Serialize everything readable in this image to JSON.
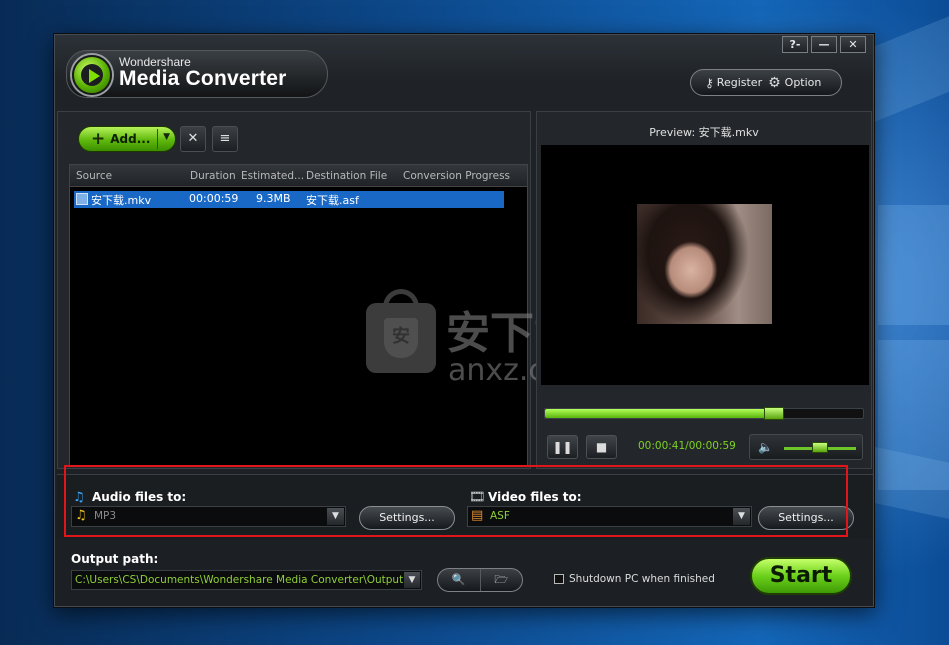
{
  "app": {
    "brand": "Wondershare",
    "product": "Media Converter"
  },
  "window_controls": {
    "help": "?-",
    "minimize": "—",
    "close": "✕"
  },
  "header": {
    "register_label": "Register",
    "option_label": "Option"
  },
  "toolbar": {
    "add_label": "Add..."
  },
  "file_list": {
    "columns": [
      "Source",
      "Duration",
      "Estimated...",
      "Destination File",
      "Conversion Progress"
    ],
    "rows": [
      {
        "source": "安下载.mkv",
        "duration": "00:00:59",
        "estimated": "9.3MB",
        "destination": "安下载.asf",
        "progress": ""
      }
    ]
  },
  "watermark": {
    "cn": "安下载",
    "en": "anxz.com",
    "mark": "安"
  },
  "preview": {
    "title": "Preview: 安下载.mkv",
    "subtitle": "",
    "playback_progress": 0.72,
    "time": "00:00:41/00:00:59",
    "volume_level": 0.5
  },
  "audio": {
    "label": "Audio files to:",
    "format": "MP3",
    "settings_label": "Settings..."
  },
  "video": {
    "label": "Video files to:",
    "format": "ASF",
    "settings_label": "Settings..."
  },
  "output": {
    "label": "Output path:",
    "path": "C:\\Users\\CS\\Documents\\Wondershare Media Converter\\Output",
    "shutdown_label": "Shutdown PC when finished",
    "shutdown_checked": false,
    "start_label": "Start"
  },
  "colors": {
    "accent_green": "#7ed321",
    "selection_blue": "#1968c6",
    "highlight_red": "#e0161a"
  }
}
